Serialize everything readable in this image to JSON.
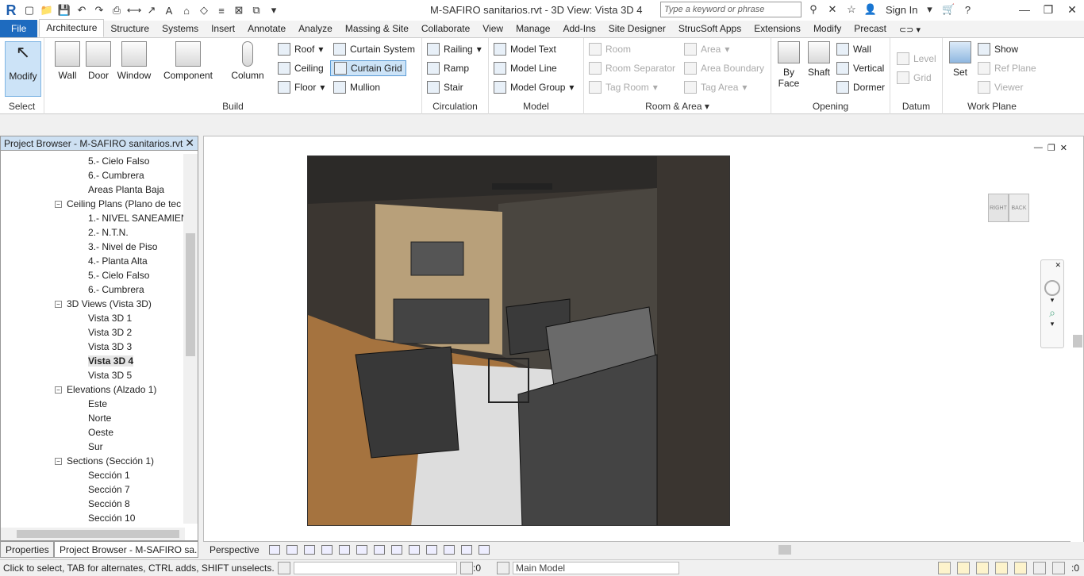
{
  "window": {
    "title": "M-SAFIRO  sanitarios.rvt - 3D View: Vista 3D 4",
    "search_placeholder": "Type a keyword or phrase",
    "sign_in": "Sign In"
  },
  "tabs": [
    "File",
    "Architecture",
    "Structure",
    "Systems",
    "Insert",
    "Annotate",
    "Analyze",
    "Massing & Site",
    "Collaborate",
    "View",
    "Manage",
    "Add-Ins",
    "Site Designer",
    "StrucSoft Apps",
    "Extensions",
    "Modify",
    "Precast"
  ],
  "active_tab": "Architecture",
  "ribbon": {
    "select": {
      "modify": "Modify",
      "label": "Select"
    },
    "build": {
      "label": "Build",
      "wall": "Wall",
      "door": "Door",
      "window": "Window",
      "component": "Component",
      "column": "Column",
      "roof": "Roof",
      "ceiling": "Ceiling",
      "floor": "Floor",
      "curtain_system": "Curtain System",
      "curtain_grid": "Curtain Grid",
      "mullion": "Mullion"
    },
    "circulation": {
      "label": "Circulation",
      "railing": "Railing",
      "ramp": "Ramp",
      "stair": "Stair"
    },
    "model": {
      "label": "Model",
      "text": "Model  Text",
      "line": "Model  Line",
      "group": "Model  Group"
    },
    "room_area": {
      "label": "Room & Area",
      "room": "Room",
      "room_separator": "Room  Separator",
      "tag_room": "Tag  Room",
      "area": "Area",
      "area_boundary": "Area  Boundary",
      "tag_area": "Tag  Area"
    },
    "opening": {
      "label": "Opening",
      "by_face": "By",
      "by_face2": "Face",
      "shaft": "Shaft",
      "wall": "Wall",
      "vertical": "Vertical",
      "dormer": "Dormer"
    },
    "datum": {
      "label": "Datum",
      "level": "Level",
      "grid": "Grid"
    },
    "work_plane": {
      "label": "Work Plane",
      "set": "Set",
      "show": "Show",
      "ref_plane": "Ref  Plane",
      "viewer": "Viewer"
    }
  },
  "browser": {
    "title": "Project Browser - M-SAFIRO  sanitarios.rvt",
    "items": [
      {
        "label": "5.- Cielo Falso",
        "level": 2
      },
      {
        "label": "6.- Cumbrera",
        "level": 2
      },
      {
        "label": "Areas Planta Baja",
        "level": 2
      },
      {
        "label": "Ceiling Plans (Plano de tec",
        "level": 1,
        "expander": "−"
      },
      {
        "label": "1.- NIVEL SANEAMIEN",
        "level": 2
      },
      {
        "label": "2.- N.T.N.",
        "level": 2
      },
      {
        "label": "3.- Nivel de Piso",
        "level": 2
      },
      {
        "label": "4.- Planta Alta",
        "level": 2
      },
      {
        "label": "5.- Cielo Falso",
        "level": 2
      },
      {
        "label": "6.- Cumbrera",
        "level": 2
      },
      {
        "label": "3D Views (Vista 3D)",
        "level": 1,
        "expander": "−"
      },
      {
        "label": "Vista 3D 1",
        "level": 2
      },
      {
        "label": "Vista 3D 2",
        "level": 2
      },
      {
        "label": "Vista 3D 3",
        "level": 2
      },
      {
        "label": "Vista 3D 4",
        "level": 2,
        "selected": true
      },
      {
        "label": "Vista 3D 5",
        "level": 2
      },
      {
        "label": "Elevations (Alzado 1)",
        "level": 1,
        "expander": "−"
      },
      {
        "label": "Este",
        "level": 2
      },
      {
        "label": "Norte",
        "level": 2
      },
      {
        "label": "Oeste",
        "level": 2
      },
      {
        "label": "Sur",
        "level": 2
      },
      {
        "label": "Sections (Sección  1)",
        "level": 1,
        "expander": "−"
      },
      {
        "label": "Sección 1",
        "level": 2
      },
      {
        "label": "Sección 7",
        "level": 2
      },
      {
        "label": "Sección 8",
        "level": 2
      },
      {
        "label": "Sección 10",
        "level": 2
      }
    ]
  },
  "bottom_tabs": [
    "Properties",
    "Project Browser - M-SAFIRO  sa..."
  ],
  "viewbar": {
    "scale": "Perspective"
  },
  "viewcube": {
    "right": "RIGHT",
    "back": "BACK"
  },
  "status": {
    "text": "Click to select, TAB for alternates, CTRL adds, SHIFT unselects.",
    "count": ":0",
    "model": "Main Model",
    "filter": ":0"
  }
}
